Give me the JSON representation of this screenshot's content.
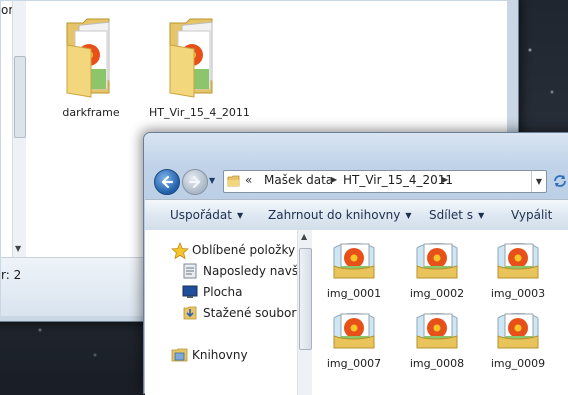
{
  "back_window": {
    "left_fragment": "ory",
    "status_text": "r: 2",
    "folders": [
      {
        "name": "darkframe"
      },
      {
        "name": "HT_Vir_15_4_2011"
      }
    ]
  },
  "front_window": {
    "address": {
      "overflow": "«",
      "crumbs": [
        "Mašek data",
        "HT_Vir_15_4_2011"
      ]
    },
    "toolbar": {
      "organize": "Uspořádat",
      "include": "Zahrnout do knihovny",
      "share": "Sdílet s",
      "burn": "Vypálit"
    },
    "nav": {
      "favorites": "Oblíbené položky",
      "recent": "Naposledy navští",
      "desktop": "Plocha",
      "downloads": "Stažené soubory",
      "libraries": "Knihovny"
    },
    "files": [
      {
        "name": "img_0001"
      },
      {
        "name": "img_0002"
      },
      {
        "name": "img_0003"
      },
      {
        "name": "img_0007"
      },
      {
        "name": "img_0008"
      },
      {
        "name": "img_0009"
      }
    ]
  },
  "icons": {
    "folder": "folder-icon",
    "image_file": "image-file-icon",
    "favorites": "star-icon",
    "recent": "recent-places-icon",
    "desktop": "desktop-icon",
    "downloads": "downloads-icon",
    "libraries": "libraries-icon"
  }
}
